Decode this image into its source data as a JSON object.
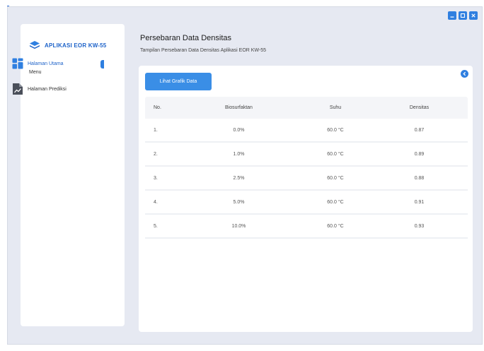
{
  "app": {
    "name": "APLIKASI EOR KW-55",
    "menu_label": "Menu"
  },
  "sidebar": {
    "items": [
      {
        "label": "Halaman Utama",
        "icon": "dashboard-icon",
        "active": true
      },
      {
        "label": "Halaman Prediksi",
        "icon": "document-chart-icon",
        "active": false
      }
    ]
  },
  "header": {
    "title": "Persebaran Data Densitas",
    "subtitle": "Tampilan Persebaran Data Densitas Aplikasi EOR KW-55"
  },
  "toolbar": {
    "grafik_button": "Lihat Grafik Data"
  },
  "table": {
    "columns": [
      "No.",
      "Biosurfaktan",
      "Suhu",
      "Densitas"
    ],
    "rows": [
      [
        "1.",
        "0.0%",
        "60.0 °C",
        "0.87"
      ],
      [
        "2.",
        "1.0%",
        "60.0 °C",
        "0.89"
      ],
      [
        "3.",
        "2.5%",
        "60.0 °C",
        "0.88"
      ],
      [
        "4.",
        "5.0%",
        "60.0 °C",
        "0.91"
      ],
      [
        "5.",
        "10.0%",
        "60.0 °C",
        "0.93"
      ]
    ]
  },
  "colors": {
    "accent": "#2f7fe0",
    "button": "#3a8ee6",
    "brand_text": "#1e63c9",
    "background": "#e6e9f2"
  }
}
